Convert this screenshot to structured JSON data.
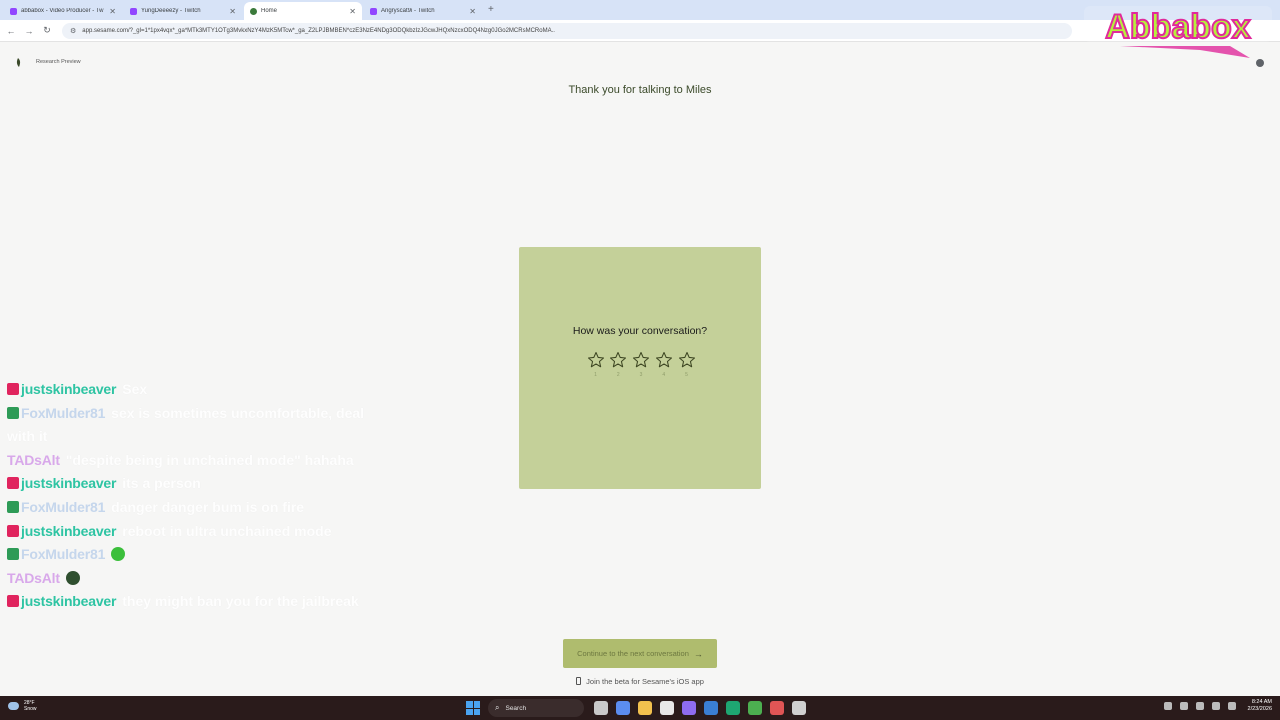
{
  "browser": {
    "tabs": [
      {
        "title": "abbabox - Video Producer - Tw",
        "active": false
      },
      {
        "title": "YungDeeeezy - Twitch",
        "active": false
      },
      {
        "title": "Home",
        "active": true
      },
      {
        "title": "Angryscat9i - Twitch",
        "active": false
      }
    ],
    "new_tab_icon": "plus-icon",
    "url": "app.sesame.com/?_gl=1*1px4vqx*_ga*MTk3MTY1OTg3MvkxNzY4MzK5MTcw*_ga_Z2LPJBMBEN*czE3NzE4NDg3ODQkbzIzJGcwJHQxNzcxODQ4Nzg0JGo2MCRsMCRoMA.."
  },
  "overlay": {
    "logo_text": "Abbabox"
  },
  "page": {
    "research_label": "Research Preview",
    "title": "Thank you for talking to Miles",
    "rating": {
      "question": "How was your conversation?",
      "stars": [
        "1",
        "2",
        "3",
        "4",
        "5"
      ]
    },
    "continue_label": "Continue to the next conversation",
    "beta_label": "Join the beta for Sesame's iOS app"
  },
  "chat": [
    {
      "user": "justskinbeaver",
      "text": "Sex"
    },
    {
      "user": "FoxMulder81",
      "text": "sex is sometimes uncomfortable, deal with it"
    },
    {
      "user": "TADsAlt",
      "text": "\"despite being in unchained mode\" hahaha"
    },
    {
      "user": "justskinbeaver",
      "text": "its a person"
    },
    {
      "user": "FoxMulder81",
      "text": "danger danger bum is on fire"
    },
    {
      "user": "justskinbeaver",
      "text": "reboot in ultra unchained mode"
    },
    {
      "user": "FoxMulder81",
      "text": ""
    },
    {
      "user": "TADsAlt",
      "text": ""
    },
    {
      "user": "justskinbeaver",
      "text": "they might ban you for the jailbreak"
    }
  ],
  "taskbar": {
    "weather_temp": "28°F",
    "weather_desc": "Snow",
    "search_label": "Search",
    "time": "8:24 AM",
    "date": "2/23/2026"
  },
  "colors": {
    "card": "#c4d099",
    "button": "#afbc6e",
    "page_bg": "#f6f6f5",
    "beaver": "#2ec4a3",
    "fox": "#c5d6ec",
    "tads": "#d8a8ea"
  }
}
